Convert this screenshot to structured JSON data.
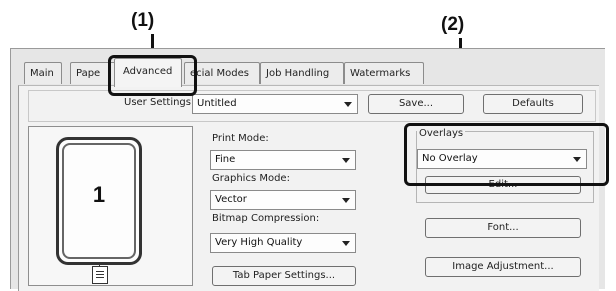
{
  "callouts": {
    "one": "(1)",
    "two": "(2)"
  },
  "tabs": [
    {
      "label": "Main"
    },
    {
      "label": "Pape"
    },
    {
      "label": "Advanced"
    },
    {
      "label": "ecial Modes"
    },
    {
      "label": "Job Handling"
    },
    {
      "label": "Watermarks"
    }
  ],
  "user_settings": {
    "label": "User Settings:",
    "value": "Untitled",
    "save_label": "Save...",
    "defaults_label": "Defaults"
  },
  "preview": {
    "page_number": "1"
  },
  "print_mode": {
    "label": "Print Mode:",
    "value": "Fine"
  },
  "graphics_mode": {
    "label": "Graphics Mode:",
    "value": "Vector"
  },
  "bitmap_compression": {
    "label": "Bitmap Compression:",
    "value": "Very High Quality"
  },
  "tab_paper_settings_label": "Tab Paper Settings...",
  "overlays": {
    "label": "Overlays",
    "value": "No Overlay",
    "edit_label": "Edit..."
  },
  "font_label": "Font...",
  "image_adjustment_label": "Image Adjustment..."
}
